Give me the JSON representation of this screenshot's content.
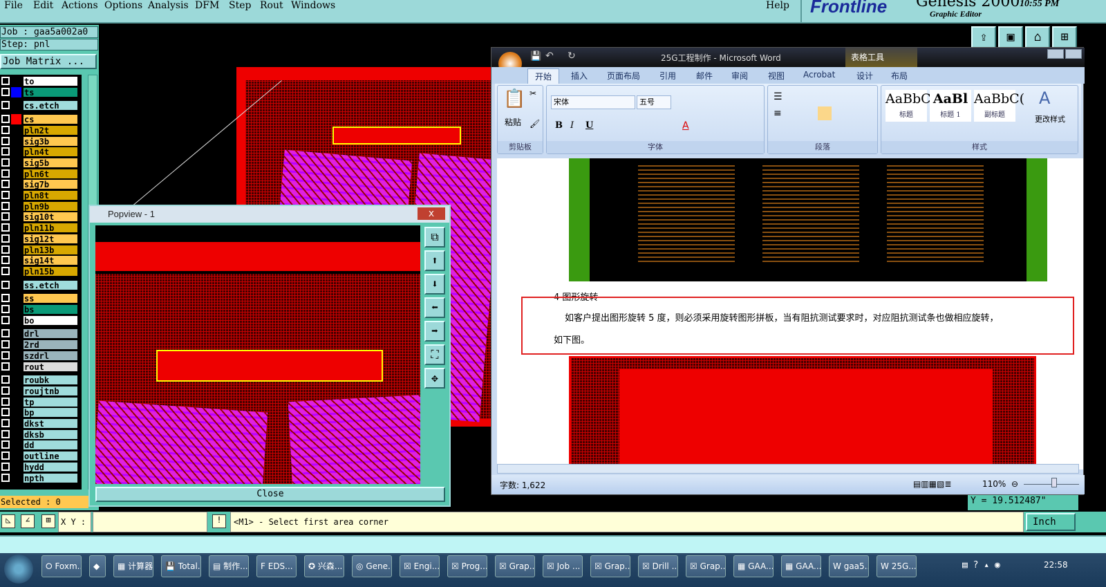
{
  "menu": {
    "items": [
      "File",
      "Edit",
      "Actions",
      "Options",
      "Analysis",
      "DFM",
      "Step",
      "Rout",
      "Windows"
    ],
    "help": "Help"
  },
  "brand": {
    "logo": "Frontline",
    "product": "Genesis 2000",
    "subtitle": "Graphic Editor",
    "clock": "10:55 PM"
  },
  "toolbar_icons": [
    "layer-up-icon",
    "layer-down-icon",
    "home-icon",
    "xy-grid-icon"
  ],
  "job": {
    "job": "Job : gaa5a002a0",
    "step": "Step: pnl",
    "matrix_button": "Job Matrix ..."
  },
  "layers": [
    {
      "name": "to",
      "color": "#ffffff",
      "swatch": null,
      "group": 1
    },
    {
      "name": "ts",
      "color": "#0a9a78",
      "swatch": "#0000ff",
      "group": 1
    },
    {
      "name": "cs.etch",
      "color": "#a0dcdc",
      "swatch": null,
      "group": 2
    },
    {
      "name": "cs",
      "color": "#ffc850",
      "swatch": "#ff0000",
      "group": 3
    },
    {
      "name": "pln2t",
      "color": "#d8a800",
      "group": 3
    },
    {
      "name": "sig3b",
      "color": "#ffc850",
      "group": 3
    },
    {
      "name": "pln4t",
      "color": "#d8a800",
      "group": 3
    },
    {
      "name": "sig5b",
      "color": "#ffc850",
      "group": 3
    },
    {
      "name": "pln6t",
      "color": "#d8a800",
      "group": 3
    },
    {
      "name": "sig7b",
      "color": "#ffc850",
      "group": 3
    },
    {
      "name": "pln8t",
      "color": "#d8a800",
      "group": 3
    },
    {
      "name": "pln9b",
      "color": "#d8a800",
      "group": 3
    },
    {
      "name": "sig10t",
      "color": "#ffc850",
      "group": 3
    },
    {
      "name": "pln11b",
      "color": "#d8a800",
      "group": 3
    },
    {
      "name": "sig12t",
      "color": "#ffc850",
      "group": 3
    },
    {
      "name": "pln13b",
      "color": "#d8a800",
      "group": 3
    },
    {
      "name": "sig14t",
      "color": "#ffc850",
      "group": 3
    },
    {
      "name": "pln15b",
      "color": "#d8a800",
      "group": 3
    },
    {
      "name": "ss.etch",
      "color": "#a0dcdc",
      "group": 4
    },
    {
      "name": "ss",
      "color": "#ffc850",
      "group": 5
    },
    {
      "name": "bs",
      "color": "#0a9a78",
      "group": 5
    },
    {
      "name": "bo",
      "color": "#ffffff",
      "group": 5
    },
    {
      "name": "drl",
      "color": "#9ab4bc",
      "group": 6
    },
    {
      "name": "2rd",
      "color": "#9ab4bc",
      "group": 6
    },
    {
      "name": "szdrl",
      "color": "#9ab4bc",
      "group": 6
    },
    {
      "name": "rout",
      "color": "#dcdcdc",
      "group": 6
    },
    {
      "name": "roubk",
      "color": "#a0dcdc",
      "group": 7
    },
    {
      "name": "roujtnb",
      "color": "#a0dcdc",
      "group": 7
    },
    {
      "name": "tp",
      "color": "#a0dcdc",
      "group": 7
    },
    {
      "name": "bp",
      "color": "#a0dcdc",
      "group": 7
    },
    {
      "name": "dkst",
      "color": "#a0dcdc",
      "group": 7
    },
    {
      "name": "dksb",
      "color": "#a0dcdc",
      "group": 7
    },
    {
      "name": "dd",
      "color": "#a0dcdc",
      "group": 7
    },
    {
      "name": "outline",
      "color": "#a0dcdc",
      "group": 7
    },
    {
      "name": "hydd",
      "color": "#a0dcdc",
      "group": 7
    },
    {
      "name": "npth",
      "color": "#a0dcdc",
      "group": 7
    }
  ],
  "selected": "Selected : 0",
  "popview": {
    "title": "Popview - 1",
    "close_x": "x",
    "close_button": "Close",
    "side_icons": [
      "zoom-fit-icon",
      "pan-up-icon",
      "pan-down-icon",
      "pan-left-icon",
      "pan-right-icon",
      "zoom-out-icon",
      "zoom-home-icon"
    ]
  },
  "word": {
    "title": "25G工程制作 - Microsoft Word",
    "context_tab": "表格工具",
    "tabs": [
      "开始",
      "插入",
      "页面布局",
      "引用",
      "邮件",
      "审阅",
      "视图",
      "Acrobat",
      "设计",
      "布局"
    ],
    "font_name": "宋体",
    "font_size": "五号",
    "groups": [
      "剪贴板",
      "字体",
      "段落",
      "样式"
    ],
    "paste": "粘贴",
    "styles": [
      {
        "sample": "AaBbC(",
        "name": "标题"
      },
      {
        "sample": "AaBl",
        "name": "标题 1"
      },
      {
        "sample": "AaBbC(",
        "name": "副标题"
      }
    ],
    "change_styles": "更改样式",
    "heading": "4 图形旋转",
    "paragraph1": "如客户提出图形旋转 5 度，则必须采用旋转图形拼板，当有阻抗测试要求时，对应阻抗测试条也做相应旋转，",
    "paragraph2": "如下图。",
    "word_count": "字数: 1,622",
    "zoom": "110%",
    "zoom_level_percent": 110
  },
  "coord": "Y = 19.512487\"",
  "command": {
    "xy_label": "X Y :",
    "xy_value": "",
    "prompt": "<M1> - Select first area corner",
    "units": "Inch"
  },
  "taskbar": {
    "items": [
      "Foxm...",
      "",
      "计算器",
      "Total...",
      "制作...",
      "EDS...",
      "兴森...",
      "Gene...",
      "Engi...",
      "Prog...",
      "Grap...",
      "Job ...",
      "Grap...",
      "Drill ...",
      "Grap...",
      "GAA...",
      "GAA...",
      "gaa5...",
      "25G..."
    ],
    "clock": "22:58"
  }
}
